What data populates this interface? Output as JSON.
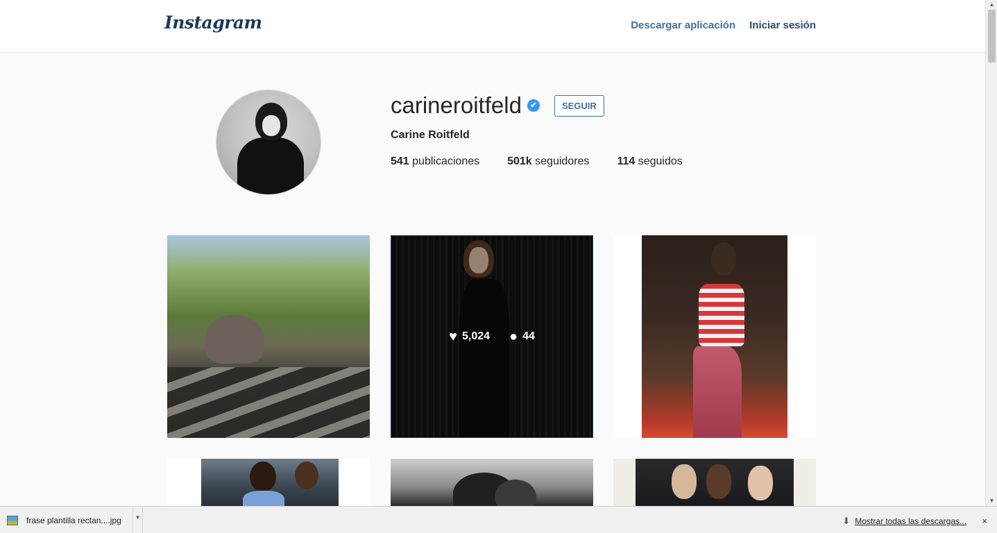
{
  "nav": {
    "logo": "Instagram",
    "download_label": "Descargar aplicación",
    "login_label": "Iniciar sesión"
  },
  "profile": {
    "username": "carineroitfeld",
    "verified_icon": "✔",
    "follow_label": "SEGUIR",
    "full_name": "Carine Roitfeld",
    "stats": {
      "posts_count": "541",
      "posts_label": "publicaciones",
      "followers_count": "501k",
      "followers_label": "seguidores",
      "following_count": "114",
      "following_label": "seguidos"
    }
  },
  "posts": {
    "hovered": {
      "likes": "5,024",
      "comments": "44",
      "like_icon": "heart-icon",
      "comment_icon": "comment-bubble-icon"
    }
  },
  "download_bar": {
    "file_name": "frase plantilla rectan....jpg",
    "show_all_label": "Mostrar todas las descargas...",
    "close_icon": "×"
  },
  "scrollbar": {
    "up_icon": "▲",
    "down_icon": "▼"
  },
  "colors": {
    "link_blue": "#3f729b",
    "verified_blue": "#3897f0",
    "background": "#fafafa"
  }
}
